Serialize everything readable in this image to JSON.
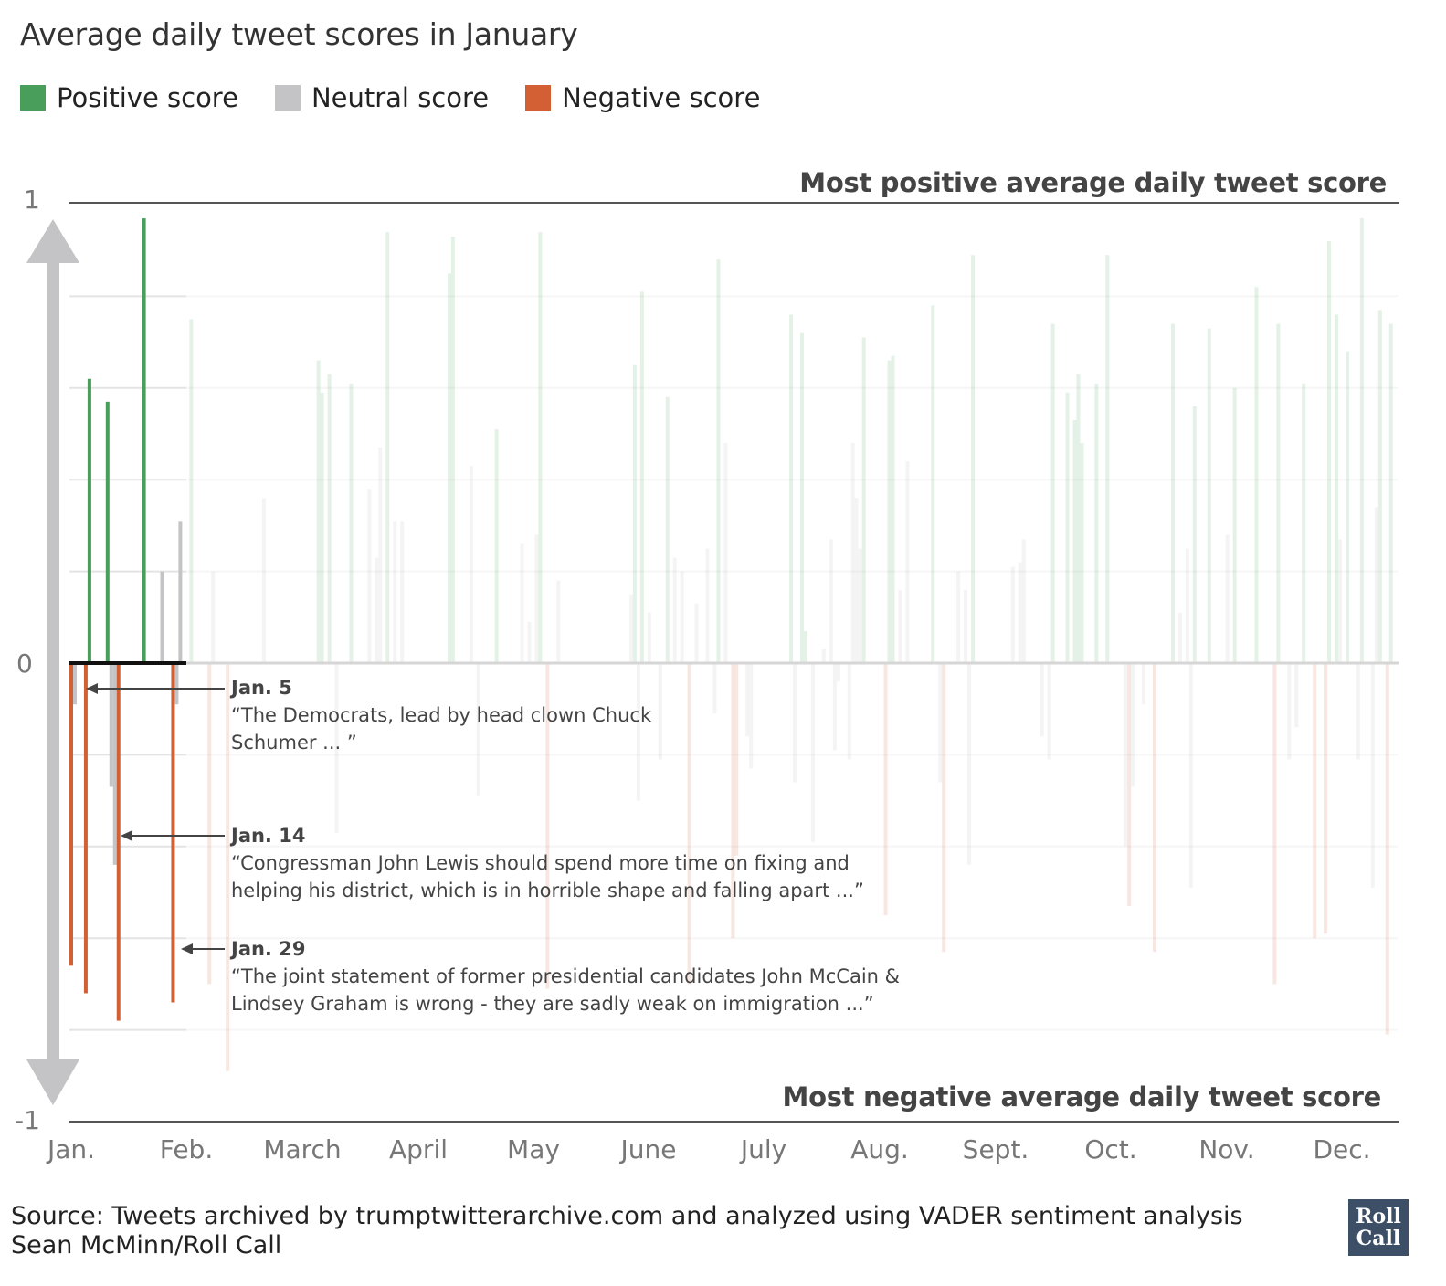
{
  "title": "Average daily tweet scores in January",
  "legend": [
    {
      "label": "Positive score",
      "color": "#4a9e5c"
    },
    {
      "label": "Neutral score",
      "color": "#c4c4c6"
    },
    {
      "label": "Negative score",
      "color": "#d35f35"
    }
  ],
  "source": "Source: Tweets archived by trumptwitterarchive.com and analyzed using VADER sentiment analysis",
  "credit": "Sean McMinn/Roll Call",
  "logo": "Roll Call",
  "chart_data": {
    "type": "bar",
    "title": "Average daily tweet scores in January",
    "top_label": "Most positive average daily tweet score",
    "bottom_label": "Most negative average daily tweet score",
    "ylim": [
      -1,
      1
    ],
    "yticks": [
      "1",
      "0",
      "-1"
    ],
    "xticks": [
      "Jan.",
      "Feb.",
      "March",
      "April",
      "May",
      "June",
      "July",
      "Aug.",
      "Sept.",
      "Oct.",
      "Nov.",
      "Dec."
    ],
    "highlight_month": "Jan.",
    "grid": true,
    "legend_placement": "top-left",
    "colors": {
      "positive": "#4a9e5c",
      "neutral": "#c4c4c6",
      "negative": "#d35f35"
    },
    "annotations": [
      {
        "date": "Jan. 5",
        "text": "“The Democrats, lead by head clown Chuck Schumer ... ”"
      },
      {
        "date": "Jan. 14",
        "text": "“Congressman John Lewis should spend more time on fixing and helping his district, which is in horrible shape and falling apart ...”"
      },
      {
        "date": "Jan. 29",
        "text": "“The joint statement of former presidential candidates John McCain & Lindsey Graham is wrong - they are sadly weak on immigration ...”"
      }
    ],
    "bars": [
      [
        "01-01",
        -0.66,
        "negative"
      ],
      [
        "01-02",
        -0.09,
        "neutral"
      ],
      [
        "01-05",
        -0.72,
        "negative"
      ],
      [
        "01-06",
        0.62,
        "positive"
      ],
      [
        "01-11",
        0.57,
        "positive"
      ],
      [
        "01-12",
        -0.27,
        "neutral"
      ],
      [
        "01-13",
        -0.44,
        "neutral"
      ],
      [
        "01-14",
        -0.78,
        "negative"
      ],
      [
        "01-21",
        0.97,
        "positive"
      ],
      [
        "01-26",
        0.2,
        "neutral"
      ],
      [
        "01-29",
        -0.74,
        "negative"
      ],
      [
        "01-30",
        -0.09,
        "neutral"
      ],
      [
        "01-31",
        0.31,
        "neutral"
      ],
      [
        "02-03",
        0.75,
        "positive"
      ],
      [
        "02-08",
        -0.7,
        "negative"
      ],
      [
        "02-09",
        0.2,
        "neutral"
      ],
      [
        "02-13",
        -0.89,
        "negative"
      ],
      [
        "02-23",
        0.36,
        "neutral"
      ],
      [
        "03-10",
        0.66,
        "positive"
      ],
      [
        "03-11",
        0.59,
        "positive"
      ],
      [
        "03-13",
        0.63,
        "positive"
      ],
      [
        "03-15",
        -0.37,
        "neutral"
      ],
      [
        "03-19",
        0.61,
        "positive"
      ],
      [
        "03-24",
        0.38,
        "neutral"
      ],
      [
        "03-26",
        0.23,
        "neutral"
      ],
      [
        "03-27",
        0.47,
        "neutral"
      ],
      [
        "03-29",
        0.94,
        "positive"
      ],
      [
        "03-31",
        0.31,
        "neutral"
      ],
      [
        "04-02",
        0.31,
        "neutral"
      ],
      [
        "04-15",
        0.85,
        "positive"
      ],
      [
        "04-16",
        0.93,
        "positive"
      ],
      [
        "04-21",
        0.43,
        "neutral"
      ],
      [
        "04-23",
        -0.29,
        "neutral"
      ],
      [
        "04-28",
        0.51,
        "positive"
      ],
      [
        "05-05",
        0.26,
        "neutral"
      ],
      [
        "05-07",
        0.09,
        "neutral"
      ],
      [
        "05-09",
        0.28,
        "neutral"
      ],
      [
        "05-10",
        0.94,
        "positive"
      ],
      [
        "05-12",
        -0.71,
        "negative"
      ],
      [
        "05-15",
        0.18,
        "neutral"
      ],
      [
        "06-04",
        0.15,
        "neutral"
      ],
      [
        "06-05",
        0.65,
        "positive"
      ],
      [
        "06-06",
        -0.3,
        "neutral"
      ],
      [
        "06-07",
        0.81,
        "positive"
      ],
      [
        "06-09",
        0.11,
        "neutral"
      ],
      [
        "06-12",
        -0.21,
        "neutral"
      ],
      [
        "06-14",
        0.58,
        "positive"
      ],
      [
        "06-16",
        0.23,
        "neutral"
      ],
      [
        "06-18",
        0.2,
        "neutral"
      ],
      [
        "06-20",
        -0.7,
        "negative"
      ],
      [
        "06-22",
        0.13,
        "neutral"
      ],
      [
        "06-25",
        0.25,
        "neutral"
      ],
      [
        "06-27",
        -0.11,
        "neutral"
      ],
      [
        "06-28",
        0.88,
        "positive"
      ],
      [
        "06-30",
        0.48,
        "neutral"
      ],
      [
        "07-02",
        -0.6,
        "negative"
      ],
      [
        "07-03",
        -0.42,
        "negative"
      ],
      [
        "07-06",
        -0.16,
        "neutral"
      ],
      [
        "07-07",
        -0.23,
        "neutral"
      ],
      [
        "07-18",
        0.76,
        "positive"
      ],
      [
        "07-19",
        -0.26,
        "neutral"
      ],
      [
        "07-21",
        0.72,
        "positive"
      ],
      [
        "07-22",
        0.07,
        "positive"
      ],
      [
        "07-24",
        -0.39,
        "neutral"
      ],
      [
        "07-27",
        0.03,
        "neutral"
      ],
      [
        "07-29",
        0.27,
        "neutral"
      ],
      [
        "07-30",
        -0.19,
        "neutral"
      ],
      [
        "07-31",
        -0.04,
        "neutral"
      ],
      [
        "08-03",
        -0.21,
        "neutral"
      ],
      [
        "08-04",
        0.48,
        "neutral"
      ],
      [
        "08-05",
        0.36,
        "neutral"
      ],
      [
        "08-06",
        0.25,
        "neutral"
      ],
      [
        "08-07",
        0.71,
        "positive"
      ],
      [
        "08-13",
        -0.55,
        "negative"
      ],
      [
        "08-14",
        0.66,
        "positive"
      ],
      [
        "08-15",
        0.67,
        "positive"
      ],
      [
        "08-17",
        0.16,
        "neutral"
      ],
      [
        "08-19",
        0.44,
        "neutral"
      ],
      [
        "08-26",
        0.78,
        "positive"
      ],
      [
        "08-28",
        -0.26,
        "neutral"
      ],
      [
        "08-29",
        -0.63,
        "negative"
      ],
      [
        "09-02",
        0.2,
        "neutral"
      ],
      [
        "09-04",
        0.16,
        "neutral"
      ],
      [
        "09-05",
        -0.44,
        "neutral"
      ],
      [
        "09-06",
        0.89,
        "positive"
      ],
      [
        "09-17",
        0.21,
        "neutral"
      ],
      [
        "09-19",
        0.22,
        "neutral"
      ],
      [
        "09-20",
        0.27,
        "neutral"
      ],
      [
        "09-25",
        -0.16,
        "neutral"
      ],
      [
        "09-27",
        -0.21,
        "neutral"
      ],
      [
        "09-28",
        0.74,
        "positive"
      ],
      [
        "10-02",
        0.59,
        "positive"
      ],
      [
        "10-04",
        0.53,
        "positive"
      ],
      [
        "10-05",
        0.63,
        "positive"
      ],
      [
        "10-06",
        0.48,
        "positive"
      ],
      [
        "10-10",
        0.61,
        "positive"
      ],
      [
        "10-13",
        0.89,
        "positive"
      ],
      [
        "10-18",
        -0.4,
        "neutral"
      ],
      [
        "10-19",
        -0.53,
        "negative"
      ],
      [
        "10-20",
        -0.27,
        "neutral"
      ],
      [
        "10-23",
        -0.09,
        "neutral"
      ],
      [
        "10-26",
        -0.63,
        "negative"
      ],
      [
        "10-31",
        0.74,
        "positive"
      ],
      [
        "11-02",
        0.11,
        "neutral"
      ],
      [
        "11-04",
        0.25,
        "neutral"
      ],
      [
        "11-05",
        -0.49,
        "neutral"
      ],
      [
        "11-06",
        0.56,
        "positive"
      ],
      [
        "11-10",
        0.73,
        "positive"
      ],
      [
        "11-15",
        0.28,
        "neutral"
      ],
      [
        "11-17",
        0.6,
        "positive"
      ],
      [
        "11-23",
        0.82,
        "positive"
      ],
      [
        "11-28",
        -0.7,
        "negative"
      ],
      [
        "11-29",
        0.74,
        "positive"
      ],
      [
        "12-02",
        -0.21,
        "neutral"
      ],
      [
        "12-04",
        -0.14,
        "neutral"
      ],
      [
        "12-06",
        0.61,
        "positive"
      ],
      [
        "12-09",
        -0.6,
        "negative"
      ],
      [
        "12-12",
        -0.59,
        "negative"
      ],
      [
        "12-13",
        0.92,
        "positive"
      ],
      [
        "12-15",
        0.76,
        "positive"
      ],
      [
        "12-16",
        0.27,
        "neutral"
      ],
      [
        "12-18",
        0.68,
        "positive"
      ],
      [
        "12-21",
        -0.21,
        "neutral"
      ],
      [
        "12-22",
        0.97,
        "positive"
      ],
      [
        "12-25",
        -0.49,
        "neutral"
      ],
      [
        "12-26",
        0.34,
        "neutral"
      ],
      [
        "12-27",
        0.77,
        "positive"
      ],
      [
        "12-29",
        -0.81,
        "negative"
      ],
      [
        "12-30",
        0.74,
        "positive"
      ]
    ]
  }
}
